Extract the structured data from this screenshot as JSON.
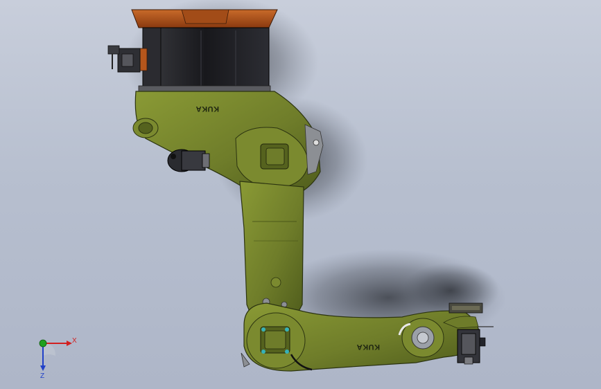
{
  "model": {
    "brand_label_upper": "KUKA",
    "brand_label_lower": "KUKA"
  },
  "triad": {
    "x_label": "X",
    "z_label": "Z"
  },
  "colors": {
    "background_top": "#c8cedb",
    "background_bottom": "#aeb6c8",
    "arm_green": "#6f7d2a",
    "arm_green_dark": "#4d5a1b",
    "base_orange": "#b5561c",
    "base_dark": "#1e1e22",
    "x_axis": "#d22020",
    "y_axis": "#1fa01f",
    "z_axis": "#2040c8"
  }
}
